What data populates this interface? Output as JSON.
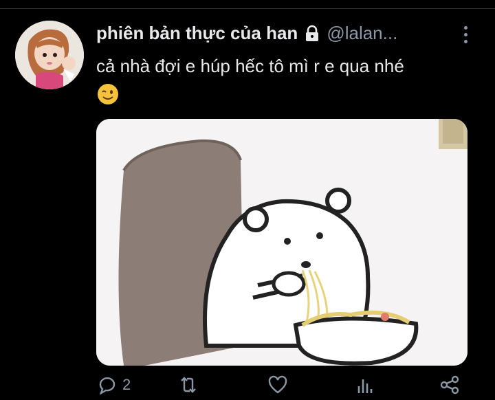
{
  "tweet": {
    "display_name": "phiên bản thực của han",
    "handle": "@lalan...",
    "text": "cả nhà đợi e húp hếc tô mì r e qua nhé",
    "emoji": "winking-face",
    "media": {
      "description_icon": "bear-eating-noodles-image"
    },
    "actions": {
      "reply_count": "2",
      "retweet_count": "",
      "like_count": ""
    }
  },
  "colors": {
    "background": "#000000",
    "text": "#e7e9ea",
    "muted": "#8b98a5",
    "divider": "#2f3336"
  }
}
